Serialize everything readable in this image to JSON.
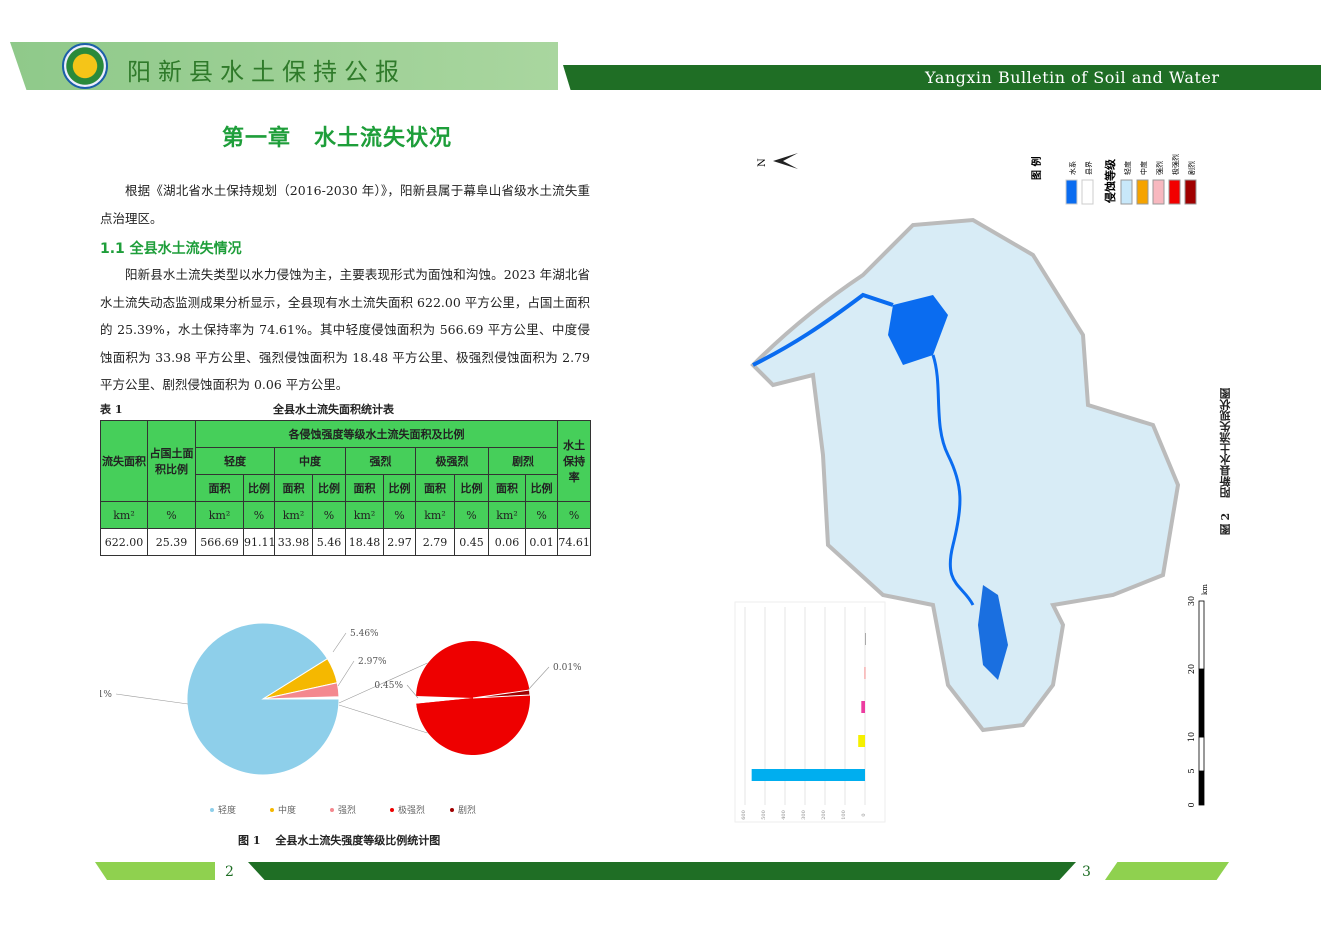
{
  "header": {
    "title": "阳新县水土保持公报",
    "subtitle_en": "Yangxin Bulletin of Soil and Water Conservation"
  },
  "chapter_title": "第一章　水土流失状况",
  "intro": "根据《湖北省水土保持规划（2016-2030 年）》，阳新县属于幕阜山省级水土流失重点治理区。",
  "section": {
    "title": "1.1  全县水土流失情况",
    "body": "阳新县水土流失类型以水力侵蚀为主，主要表现形式为面蚀和沟蚀。2023 年湖北省水土流失动态监测成果分析显示，全县现有水土流失面积 622.00 平方公里，占国土面积的 25.39%，水土保持率为 74.61%。其中轻度侵蚀面积为 566.69 平方公里、中度侵蚀面积为 33.98 平方公里、强烈侵蚀面积为 18.48 平方公里、极强烈侵蚀面积为 2.79 平方公里、剧烈侵蚀面积为 0.06 平方公里。"
  },
  "table": {
    "label": "表 1",
    "caption": "全县水土流失面积统计表",
    "h_loss_area": "流失面积",
    "h_ratio": "占国土面积比例",
    "h_group": "各侵蚀强度等级水土流失面积及比例",
    "h_retention": "水土保持率",
    "levels": [
      "轻度",
      "中度",
      "强烈",
      "极强烈",
      "剧烈"
    ],
    "sub_area": "面积",
    "sub_ratio": "比例",
    "unit_km": "km²",
    "unit_pct": "%",
    "row": [
      "622.00",
      "25.39",
      "566.69",
      "91.11",
      "33.98",
      "5.46",
      "18.48",
      "2.97",
      "2.79",
      "0.45",
      "0.06",
      "0.01",
      "74.61"
    ]
  },
  "chart_data": {
    "type": "pie",
    "title": "全县水土流失强度等级比例统计图",
    "categories": [
      "轻度",
      "中度",
      "强烈",
      "极强烈",
      "剧烈"
    ],
    "values": [
      91.11,
      5.46,
      2.97,
      0.45,
      0.01
    ],
    "labels": [
      "91.11%",
      "5.46%",
      "2.97%",
      "0.45%",
      "0.01%"
    ],
    "colors": [
      "#8ecfea",
      "#f5b800",
      "#f4888e",
      "#ee0000",
      "#a00000"
    ],
    "legend_position": "bottom",
    "secondary_pie": [
      "极强烈",
      "剧烈"
    ]
  },
  "figure1": {
    "caption": "图 1　 全县水土流失强度等级比例统计图"
  },
  "map": {
    "legend_title": "图 例",
    "legend_items": [
      {
        "label": "水系",
        "color": "#0a6cf0"
      },
      {
        "label": "县界",
        "color": "#ffffff"
      }
    ],
    "grade_title": "侵蚀等级",
    "grades": [
      {
        "label": "轻度",
        "color": "#c8e8fa"
      },
      {
        "label": "中度",
        "color": "#f5a300"
      },
      {
        "label": "强烈",
        "color": "#f8b8bf"
      },
      {
        "label": "极强烈",
        "color": "#f20000"
      },
      {
        "label": "剧烈",
        "color": "#a00000"
      }
    ],
    "north": "N",
    "scale_ticks": [
      "0",
      "5",
      "10",
      "20",
      "30"
    ],
    "scale_unit": "km",
    "mini_chart": {
      "ticks": [
        "0",
        "100",
        "200",
        "300",
        "400",
        "500",
        "600"
      ],
      "values": [
        566.69,
        33.98,
        18.48,
        2.79,
        0.06
      ],
      "colors": [
        "#00aeef",
        "#f5f000",
        "#ec3ca0",
        "#f28c8c",
        "#aaaaaa"
      ]
    }
  },
  "figure2": {
    "caption": "图 2　 阳新县水土流失现状图"
  },
  "pages": {
    "left": "2",
    "right": "3"
  }
}
